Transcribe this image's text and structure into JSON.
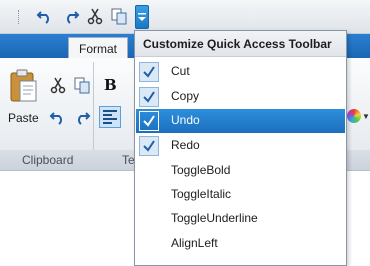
{
  "ribbon": {
    "active_tab": "Format",
    "paste_label": "Paste",
    "bold_label": "B",
    "groups": {
      "clipboard": "Clipboard",
      "text_partial": "Te"
    }
  },
  "menu": {
    "title": "Customize Quick Access Toolbar",
    "items": [
      {
        "label": "Cut",
        "checked": true
      },
      {
        "label": "Copy",
        "checked": true
      },
      {
        "label": "Undo",
        "checked": true,
        "highlighted": true
      },
      {
        "label": "Redo",
        "checked": true
      },
      {
        "label": "ToggleBold",
        "checked": false
      },
      {
        "label": "ToggleItalic",
        "checked": false
      },
      {
        "label": "ToggleUnderline",
        "checked": false
      },
      {
        "label": "AlignLeft",
        "checked": false
      }
    ]
  },
  "colors": {
    "accent": "#1c78c4",
    "highlight": "#2d8fdc"
  }
}
